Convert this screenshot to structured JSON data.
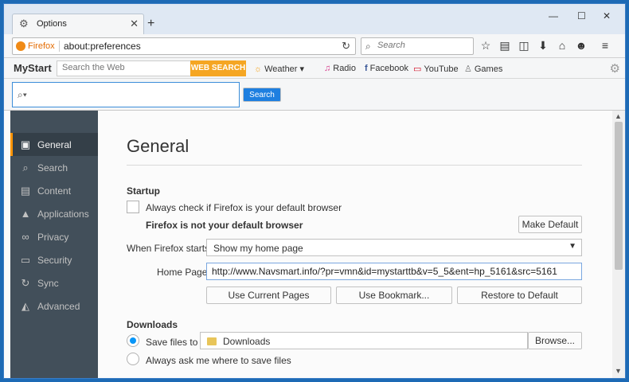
{
  "window": {
    "tab_title": "Options",
    "minimize": "—",
    "maximize": "☐",
    "close": "✕"
  },
  "navbar": {
    "identity_label": "Firefox",
    "url": "about:preferences",
    "search_placeholder": "Search"
  },
  "mystart": {
    "logo": "MyStart",
    "search_placeholder": "Search the Web",
    "web_search_label": "WEB SEARCH",
    "links": [
      {
        "label": "Weather",
        "icon": "sun-icon"
      },
      {
        "label": "Radio",
        "icon": "headphones-icon"
      },
      {
        "label": "Facebook",
        "icon": "facebook-icon"
      },
      {
        "label": "YouTube",
        "icon": "tv-icon"
      },
      {
        "label": "Games",
        "icon": "joystick-icon"
      }
    ]
  },
  "search_bar": {
    "button_label": "Search"
  },
  "sidebar": {
    "items": [
      {
        "label": "General",
        "active": true
      },
      {
        "label": "Search"
      },
      {
        "label": "Content"
      },
      {
        "label": "Applications"
      },
      {
        "label": "Privacy"
      },
      {
        "label": "Security"
      },
      {
        "label": "Sync"
      },
      {
        "label": "Advanced"
      }
    ]
  },
  "general": {
    "title": "General",
    "startup_heading": "Startup",
    "default_check_label": "Always check if Firefox is your default browser",
    "not_default_text": "Firefox is not your default browser",
    "make_default_button": "Make Default",
    "when_starts_label": "When Firefox starts:",
    "when_starts_value": "Show my home page",
    "home_page_label": "Home Page:",
    "home_page_value": "http://www.Navsmart.info/?pr=vmn&id=mystarttb&v=5_5&ent=hp_5161&src=5161",
    "use_current_button": "Use Current Pages",
    "use_bookmark_button": "Use Bookmark...",
    "restore_button": "Restore to Default",
    "downloads_heading": "Downloads",
    "save_files_label": "Save files to",
    "downloads_folder": "Downloads",
    "browse_button": "Browse...",
    "always_ask_label": "Always ask me where to save files"
  }
}
